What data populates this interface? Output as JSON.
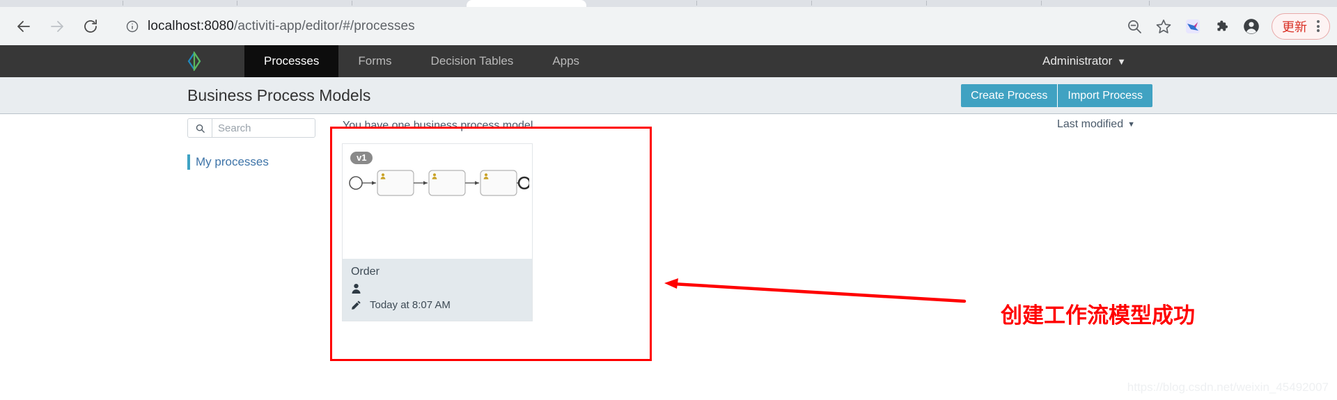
{
  "browser": {
    "back_icon": "arrow-left-icon",
    "forward_icon": "arrow-right-icon",
    "reload_icon": "reload-icon",
    "site_info_icon": "info-circle-icon",
    "url_host": "localhost:8080",
    "url_path": "/activiti-app/editor/#/processes",
    "url_full": "localhost:8080/activiti-app/editor/#/processes",
    "toolbar_icons": [
      "zoom-out-icon",
      "bookmark-star-icon",
      "extension-bird-icon",
      "extensions-puzzle-icon",
      "profile-avatar-icon"
    ],
    "update_label": "更新",
    "menu_icon": "three-dot-menu-icon"
  },
  "appnav": {
    "logo_name": "activiti-logo",
    "tabs": [
      {
        "label": "Processes",
        "active": true
      },
      {
        "label": "Forms",
        "active": false
      },
      {
        "label": "Decision Tables",
        "active": false
      },
      {
        "label": "Apps",
        "active": false
      }
    ],
    "user": "Administrator",
    "user_caret": "▼"
  },
  "header": {
    "title": "Business Process Models",
    "create_button": "Create Process",
    "import_button": "Import Process"
  },
  "sidebar": {
    "search_placeholder": "Search",
    "search_value": "",
    "search_icon": "search-icon",
    "items": [
      {
        "label": "My processes"
      }
    ]
  },
  "list": {
    "hint": "You have one business process model",
    "sort_label": "Last modified",
    "sort_caret": "▼"
  },
  "card": {
    "version": "v1",
    "title": "Order",
    "owner_icon": "user-icon",
    "edit_icon": "pencil-icon",
    "modified": "Today at 8:07 AM",
    "diagram": {
      "type": "bpmn",
      "nodes": [
        {
          "kind": "start-event",
          "label": ""
        },
        {
          "kind": "user-task",
          "label": ""
        },
        {
          "kind": "user-task",
          "label": ""
        },
        {
          "kind": "user-task",
          "label": ""
        },
        {
          "kind": "end-event",
          "label": ""
        }
      ],
      "task_icon": "user-task-icon",
      "task_icon_color": "#c9a227"
    }
  },
  "annotations": {
    "text": "创建工作流模型成功",
    "color": "#ff0000",
    "box_name": "highlight-box",
    "arrow_name": "pointer-arrow"
  },
  "watermark": "https://blog.csdn.net/weixin_45492007",
  "colors": {
    "accent_teal": "#40a2c2",
    "navbar": "#373737",
    "active_tab": "#0d0d0d",
    "header_band": "#e9edf0",
    "annotation_red": "#ff0000",
    "link_blue": "#3e74a8"
  }
}
